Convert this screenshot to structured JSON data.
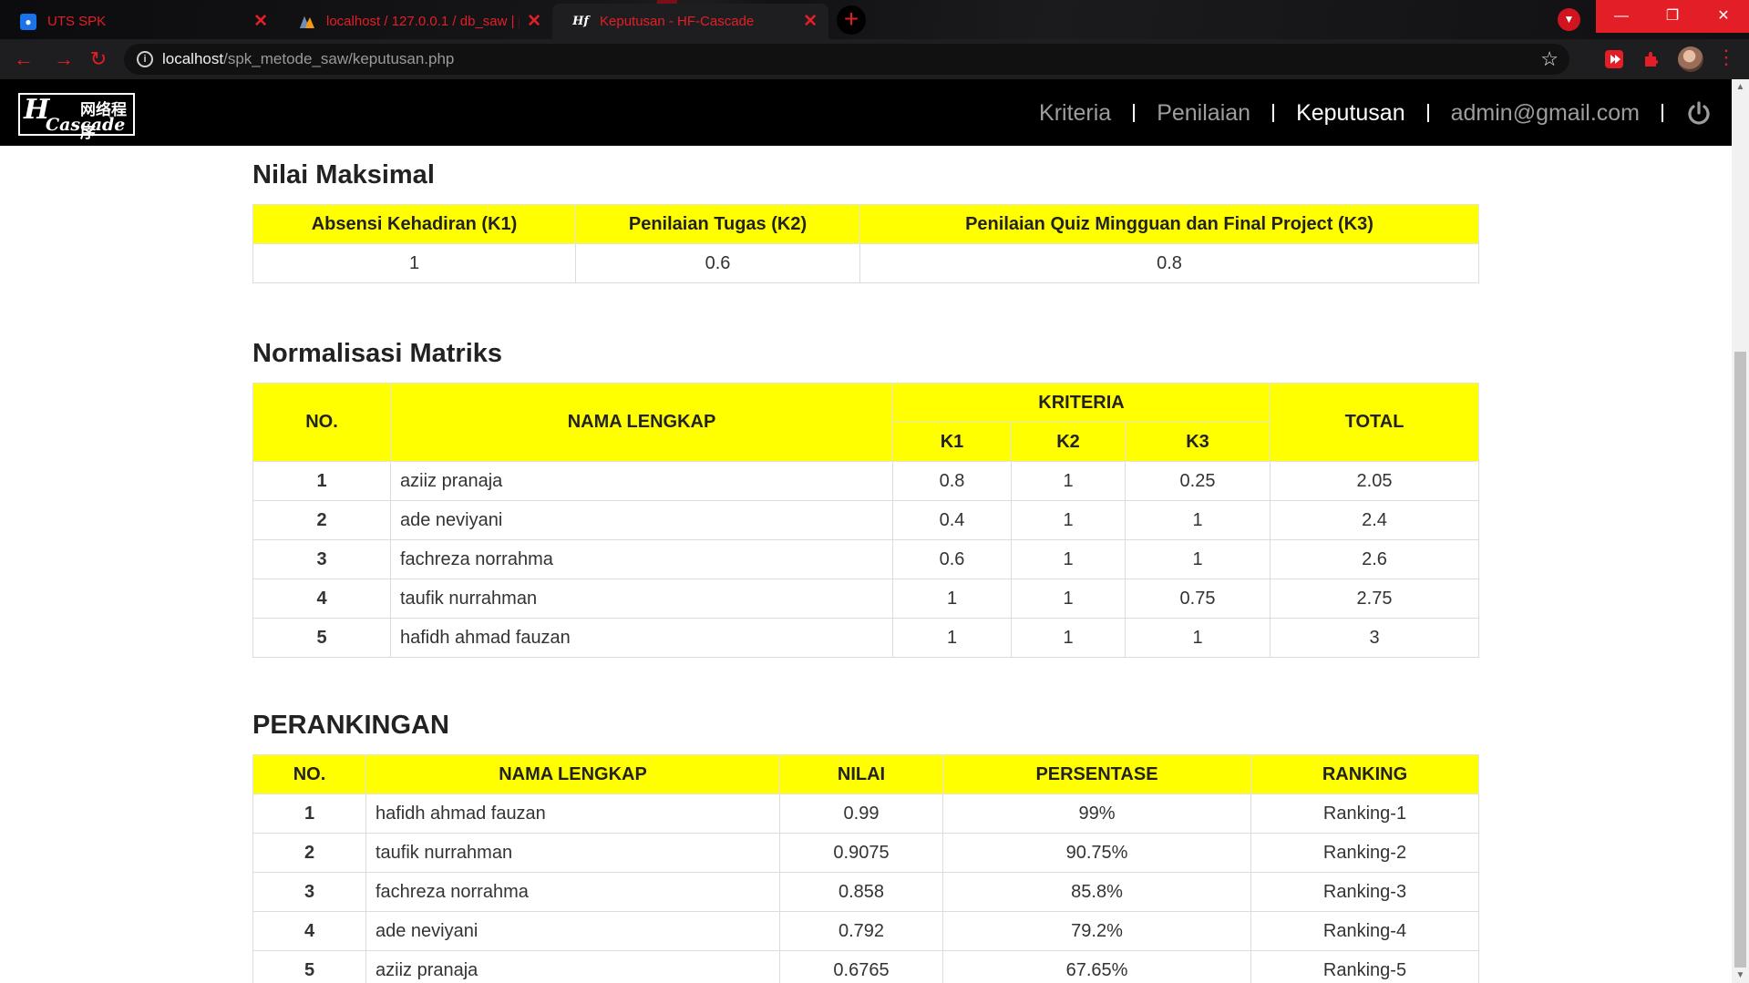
{
  "browser": {
    "tabs": [
      {
        "title": "UTS SPK",
        "favicon": "meet-icon"
      },
      {
        "title": "localhost / 127.0.0.1 / db_saw | p",
        "favicon": "phpmyadmin-icon"
      },
      {
        "title": "Keputusan - HF-Cascade",
        "favicon": "hf-logo-icon"
      }
    ],
    "url_host": "localhost",
    "url_path": "/spk_metode_saw/keputusan.php",
    "accent_color": "#e41e26"
  },
  "site": {
    "logo_text": "HF Cascade",
    "logo_cn": "网络程序",
    "nav": {
      "kriteria": "Kriteria",
      "penilaian": "Penilaian",
      "keputusan": "Keputusan",
      "user": "admin@gmail.com"
    }
  },
  "nilai_maksimal": {
    "title": "Nilai Maksimal",
    "headers": [
      "Absensi Kehadiran (K1)",
      "Penilaian Tugas (K2)",
      "Penilaian Quiz Mingguan dan Final Project (K3)"
    ],
    "values": [
      "1",
      "0.6",
      "0.8"
    ]
  },
  "normalisasi": {
    "title": "Normalisasi Matriks",
    "h_no": "NO.",
    "h_nama": "NAMA LENGKAP",
    "h_kriteria": "KRITERIA",
    "h_total": "TOTAL",
    "h_k": [
      "K1",
      "K2",
      "K3"
    ],
    "rows": [
      [
        "1",
        "aziiz pranaja",
        "0.8",
        "1",
        "0.25",
        "2.05"
      ],
      [
        "2",
        "ade neviyani",
        "0.4",
        "1",
        "1",
        "2.4"
      ],
      [
        "3",
        "fachreza norrahma",
        "0.6",
        "1",
        "1",
        "2.6"
      ],
      [
        "4",
        "taufik nurrahman",
        "1",
        "1",
        "0.75",
        "2.75"
      ],
      [
        "5",
        "hafidh ahmad fauzan",
        "1",
        "1",
        "1",
        "3"
      ]
    ]
  },
  "perankingan": {
    "title": "PERANKINGAN",
    "headers": [
      "NO.",
      "NAMA LENGKAP",
      "NILAI",
      "PERSENTASE",
      "RANKING"
    ],
    "rows": [
      [
        "1",
        "hafidh ahmad fauzan",
        "0.99",
        "99%",
        "Ranking-1"
      ],
      [
        "2",
        "taufik nurrahman",
        "0.9075",
        "90.75%",
        "Ranking-2"
      ],
      [
        "3",
        "fachreza norrahma",
        "0.858",
        "85.8%",
        "Ranking-3"
      ],
      [
        "4",
        "ade neviyani",
        "0.792",
        "79.2%",
        "Ranking-4"
      ],
      [
        "5",
        "aziiz pranaja",
        "0.6765",
        "67.65%",
        "Ranking-5"
      ]
    ]
  }
}
